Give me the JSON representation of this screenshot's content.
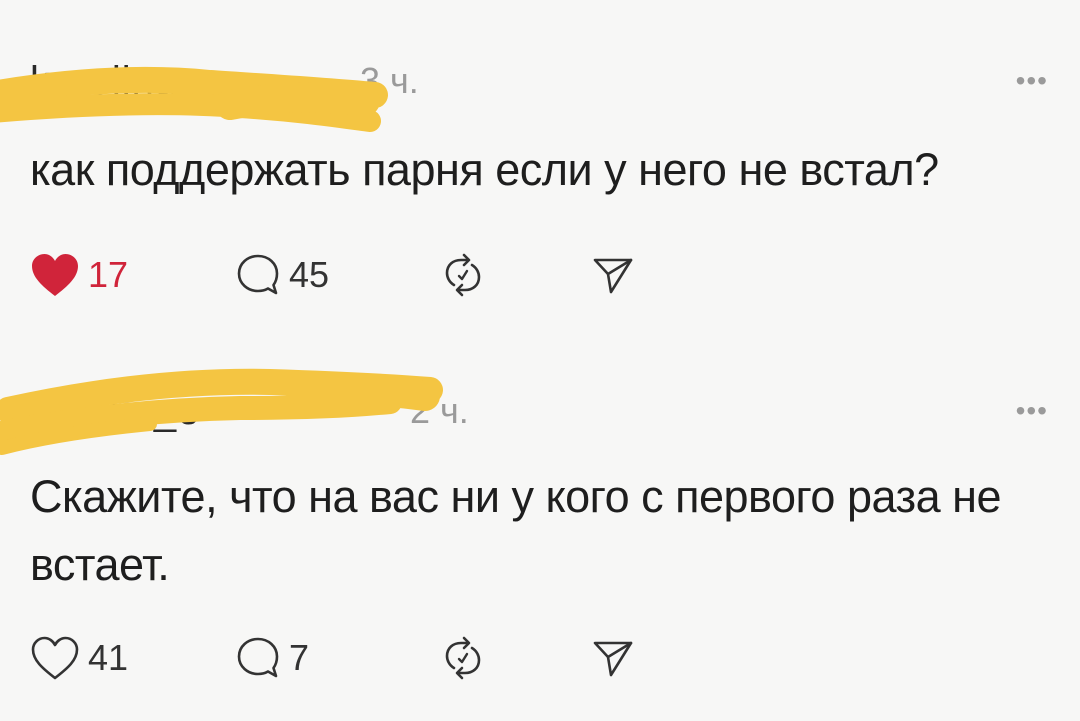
{
  "posts": [
    {
      "username": "korolina_",
      "time": "3 ч.",
      "text": "как поддержать парня если у него не встал?",
      "likes": "17",
      "liked": true,
      "replies": "45",
      "more": "•••"
    },
    {
      "username": "tochka_e",
      "time": "2 ч.",
      "text": "Скажите, что на вас ни у кого с первого раза не встает.",
      "likes": "41",
      "liked": false,
      "replies": "7",
      "more": "•••"
    }
  ],
  "colors": {
    "like_red": "#d0243a",
    "redaction_yellow": "#f4c542",
    "text": "#1e1e1e",
    "muted": "#9a9a9a"
  },
  "icons": [
    "heart-filled-icon",
    "heart-outline-icon",
    "comment-icon",
    "repost-icon",
    "share-icon",
    "more-icon"
  ]
}
